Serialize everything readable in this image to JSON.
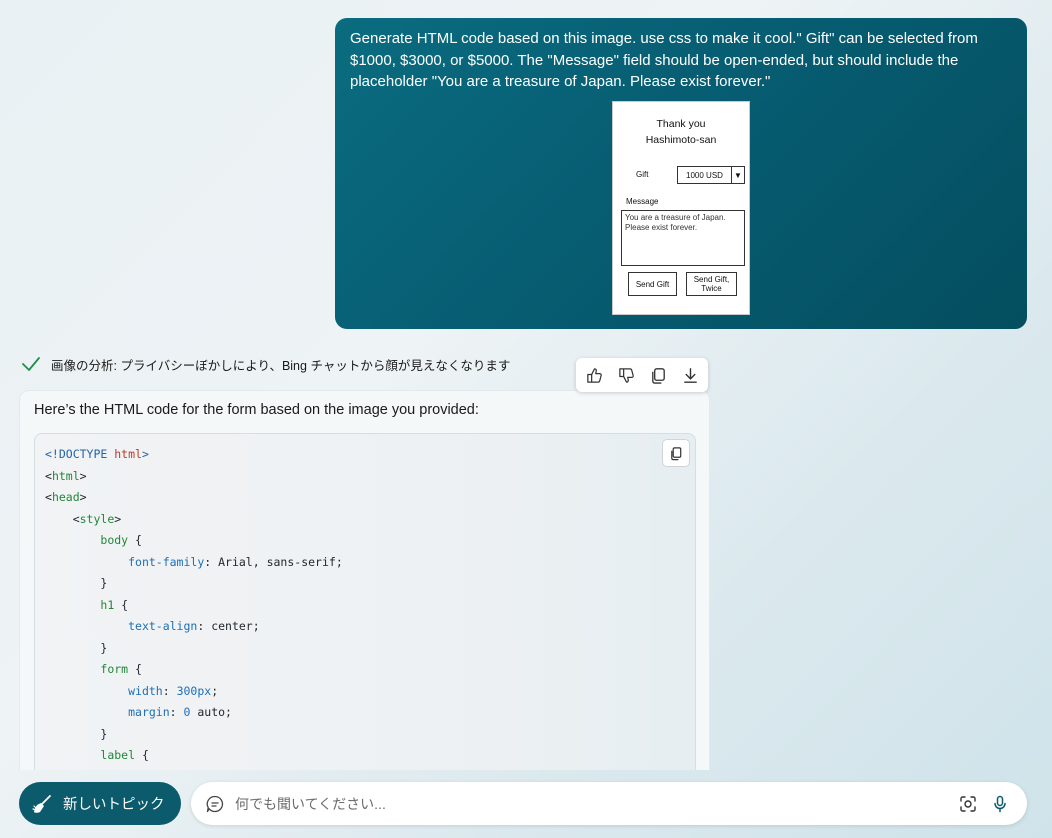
{
  "user_message": {
    "text": "Generate HTML code based on this image. use css to make it cool.\" Gift\" can be selected from $1000, $3000, or $5000. The \"Message\" field should be open-ended, but should include the placeholder \"You are a treasure of Japan. Please exist forever.\"",
    "attached_image": {
      "title_line1": "Thank you",
      "title_line2": "Hashimoto-san",
      "gift_label": "Gift",
      "gift_selected": "1000 USD",
      "message_label": "Message",
      "message_text": "You are a treasure of Japan. Please exist forever.",
      "button1": "Send Gift",
      "button2": "Send Gift, Twice"
    }
  },
  "status": {
    "text": "画像の分析: プライバシーぼかしにより、Bing チャットから顔が見えなくなります",
    "icon": "check-icon"
  },
  "toolbar": {
    "like": "thumbs-up-icon",
    "dislike": "thumbs-down-icon",
    "copy": "copy-icon",
    "export": "download-icon"
  },
  "answer": {
    "intro": "Here’s the HTML code for the form based on the image you provided:",
    "code_lines": [
      "<!DOCTYPE html>",
      "<html>",
      "<head>",
      "    <style>",
      "        body {",
      "            font-family: Arial, sans-serif;",
      "        }",
      "        h1 {",
      "            text-align: center;",
      "        }",
      "        form {",
      "            width: 300px;",
      "            margin: 0 auto;",
      "        }",
      "        label {"
    ]
  },
  "bottom": {
    "new_topic_label": "新しいトピック",
    "input_placeholder": "何でも聞いてください..."
  }
}
